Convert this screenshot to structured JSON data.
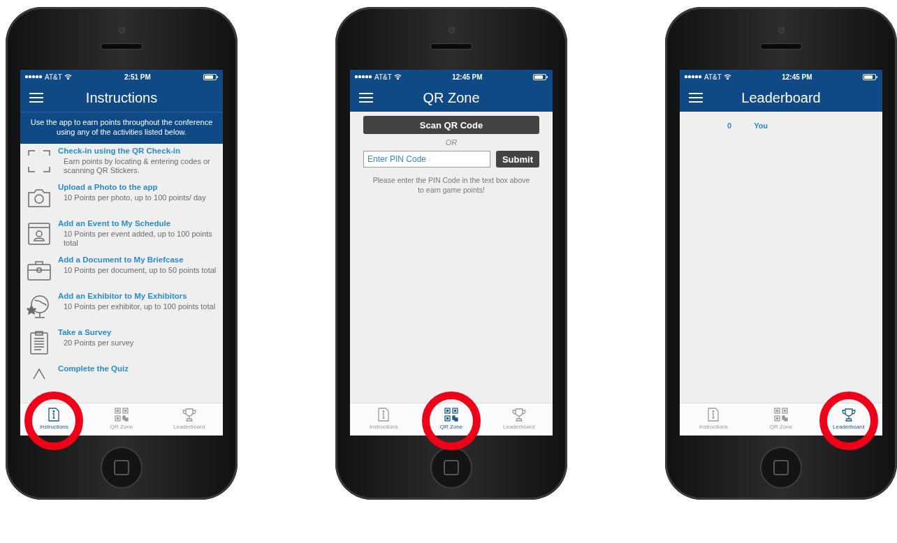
{
  "phones": [
    {
      "kind": "instructions",
      "status": {
        "carrier": "AT&T",
        "time": "2:51 PM"
      },
      "title": "Instructions",
      "intro": "Use the app to earn points throughout the conference using any of the activities listed below.",
      "activities": [
        {
          "title": "Check-in using the QR Check-in",
          "description": "Earn points by locating & entering codes or scanning QR Stickers."
        },
        {
          "title": "Upload a Photo to the app",
          "description": "10 Points per photo, up to 100 points/ day"
        },
        {
          "title": "Add an Event to My Schedule",
          "description": "10 Points per event added, up to 100 points total"
        },
        {
          "title": "Add a Document to My Briefcase",
          "description": "10 Points per document, up to 50 points total"
        },
        {
          "title": "Add an Exhibitor to My Exhibitors",
          "description": "10 Points per exhibitor, up to 100 points total"
        },
        {
          "title": "Take a Survey",
          "description": "20 Points per survey"
        },
        {
          "title": "Complete the Quiz"
        }
      ],
      "tabs": [
        {
          "label": "Instructions",
          "selected": true
        },
        {
          "label": "QR Zone",
          "selected": false
        },
        {
          "label": "Leaderboard",
          "selected": false
        }
      ]
    },
    {
      "kind": "qr",
      "status": {
        "carrier": "AT&T",
        "time": "12:45 PM"
      },
      "title": "QR Zone",
      "scan_button": "Scan QR Code",
      "or_text": "OR",
      "pin_placeholder": "Enter PIN Code",
      "submit_button": "Submit",
      "hint": "Please enter the PIN Code in the text box above to earn game points!",
      "tabs": [
        {
          "label": "Instructions",
          "selected": false
        },
        {
          "label": "QR Zone",
          "selected": true
        },
        {
          "label": "Leaderboard",
          "selected": false
        }
      ]
    },
    {
      "kind": "leaderboard",
      "status": {
        "carrier": "AT&T",
        "time": "12:45 PM"
      },
      "title": "Leaderboard",
      "rows": [
        {
          "score": "0",
          "name": "You"
        }
      ],
      "tabs": [
        {
          "label": "Instructions",
          "selected": false
        },
        {
          "label": "QR Zone",
          "selected": false
        },
        {
          "label": "Leaderboard",
          "selected": true
        }
      ]
    }
  ]
}
